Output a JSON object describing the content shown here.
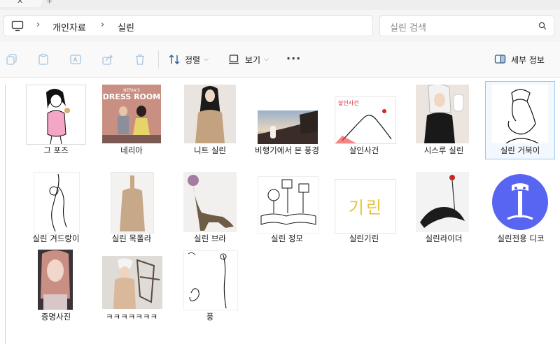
{
  "address": {
    "crumbs": [
      "개인자료",
      "실린"
    ]
  },
  "search": {
    "placeholder": "실린 검색"
  },
  "toolbar": {
    "sort_label": "정렬",
    "view_label": "보기",
    "details_label": "세부 정보"
  },
  "files": [
    {
      "name": "그 포즈"
    },
    {
      "name": "네리아"
    },
    {
      "name": "니트 실린"
    },
    {
      "name": "비행기에서 본 풍경"
    },
    {
      "name": "살인사건"
    },
    {
      "name": "시스루 실린"
    },
    {
      "name": "실린 거북이"
    },
    {
      "name": "실린 겨드랑이"
    },
    {
      "name": "실린 목폴라"
    },
    {
      "name": "실린 브라"
    },
    {
      "name": "실린 정모"
    },
    {
      "name": "실린기린"
    },
    {
      "name": "실린라이더"
    },
    {
      "name": "실린전용 디코"
    },
    {
      "name": "증명사진"
    },
    {
      "name": "ㅋㅋㅋㅋㅋㅋㅋ"
    },
    {
      "name": "풍"
    }
  ],
  "thumb_text": {
    "dress_title_small": "NERIA'S",
    "dress_title_big": "DRESS ROOM",
    "giraffe_text": "기린",
    "murder_text": "살인사건"
  },
  "colors": {
    "selection_border": "#99c9ef",
    "selection_bg": "#f2f8fd",
    "discord_blue": "#5865f2"
  }
}
